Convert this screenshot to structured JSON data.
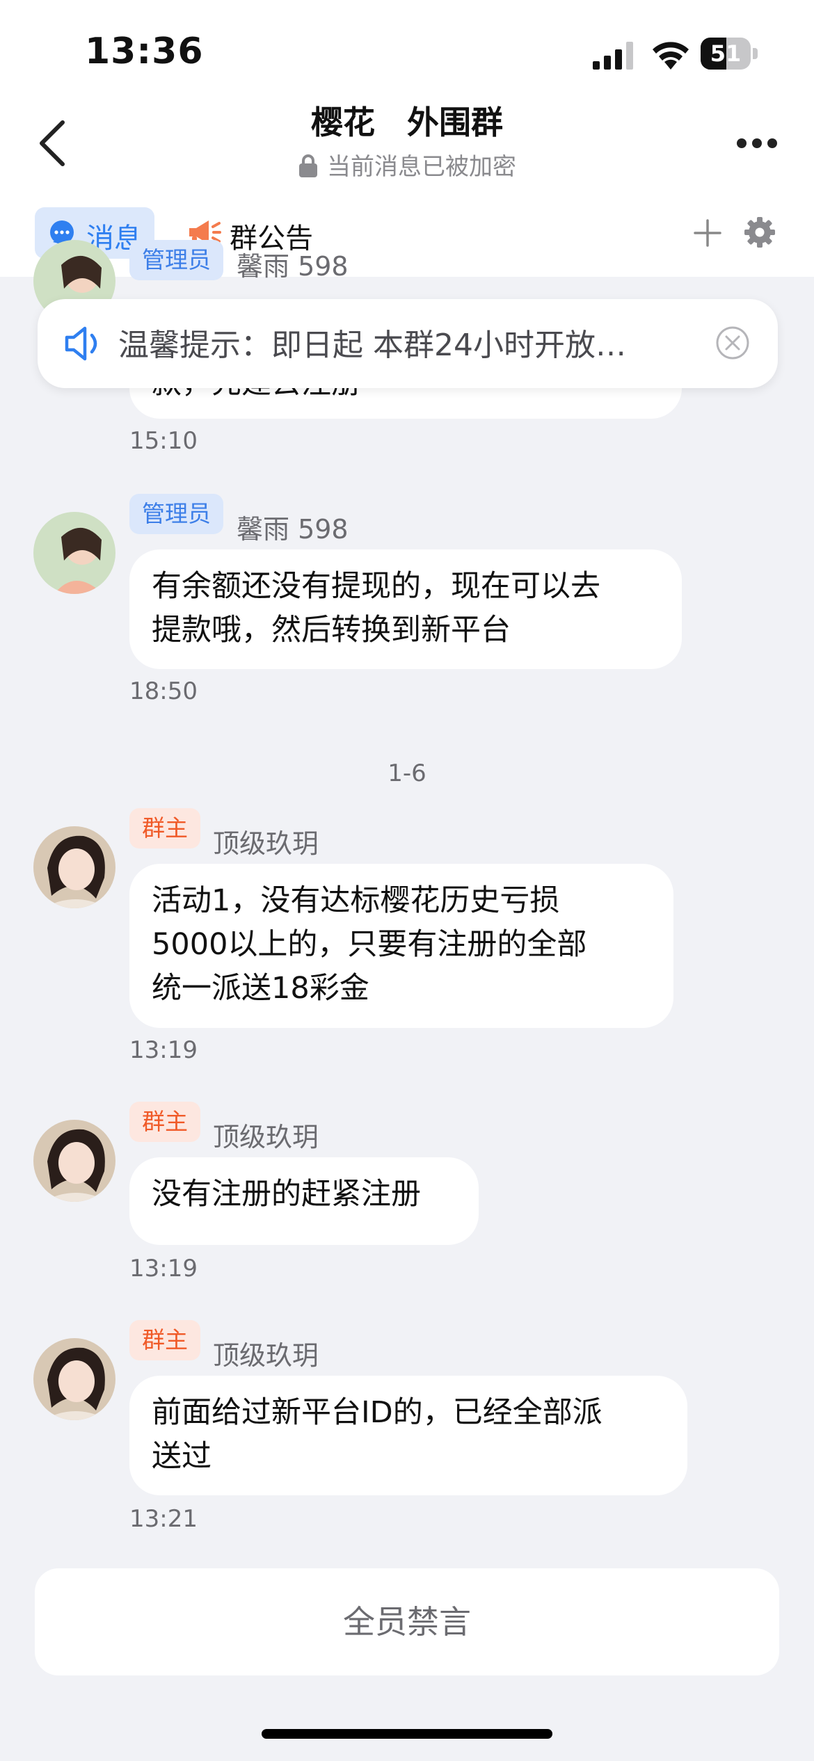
{
  "status_bar": {
    "time": "13:36",
    "battery": "51",
    "battery_level": 0.51
  },
  "nav": {
    "title": "樱花　外围群",
    "subtitle": "当前消息已被加密"
  },
  "tabs": {
    "messages": "消息",
    "announcement": "群公告"
  },
  "pinned_notice": {
    "text": "温馨提示：即日起 本群24小时开放…"
  },
  "messages": [
    {
      "role": "管理员",
      "sender": "馨雨 598",
      "lines": [
        "款，先建去注册"
      ],
      "time": "15:10"
    },
    {
      "role": "管理员",
      "sender": "馨雨 598",
      "lines": [
        "有余额还没有提现的，现在可以去",
        "提款哦，然后转换到新平台"
      ],
      "time": "18:50"
    },
    {
      "role": "群主",
      "sender": "顶级玖玥",
      "lines": [
        "活动1，没有达标樱花历史亏损",
        "5000以上的，只要有注册的全部",
        "统一派送18彩金"
      ],
      "time": "13:19"
    },
    {
      "role": "群主",
      "sender": "顶级玖玥",
      "lines": [
        "没有注册的赶紧注册"
      ],
      "time": "13:19"
    },
    {
      "role": "群主",
      "sender": "顶级玖玥",
      "lines": [
        "前面给过新平台ID的，已经全部派",
        "送过"
      ],
      "time": "13:21"
    }
  ],
  "divider_label": "1-6",
  "footer": {
    "mute_label": "全员禁言"
  },
  "colors": {
    "accent_blue": "#2f7ff0",
    "owner_orange": "#f05a28",
    "background": "#f1f2f6"
  }
}
